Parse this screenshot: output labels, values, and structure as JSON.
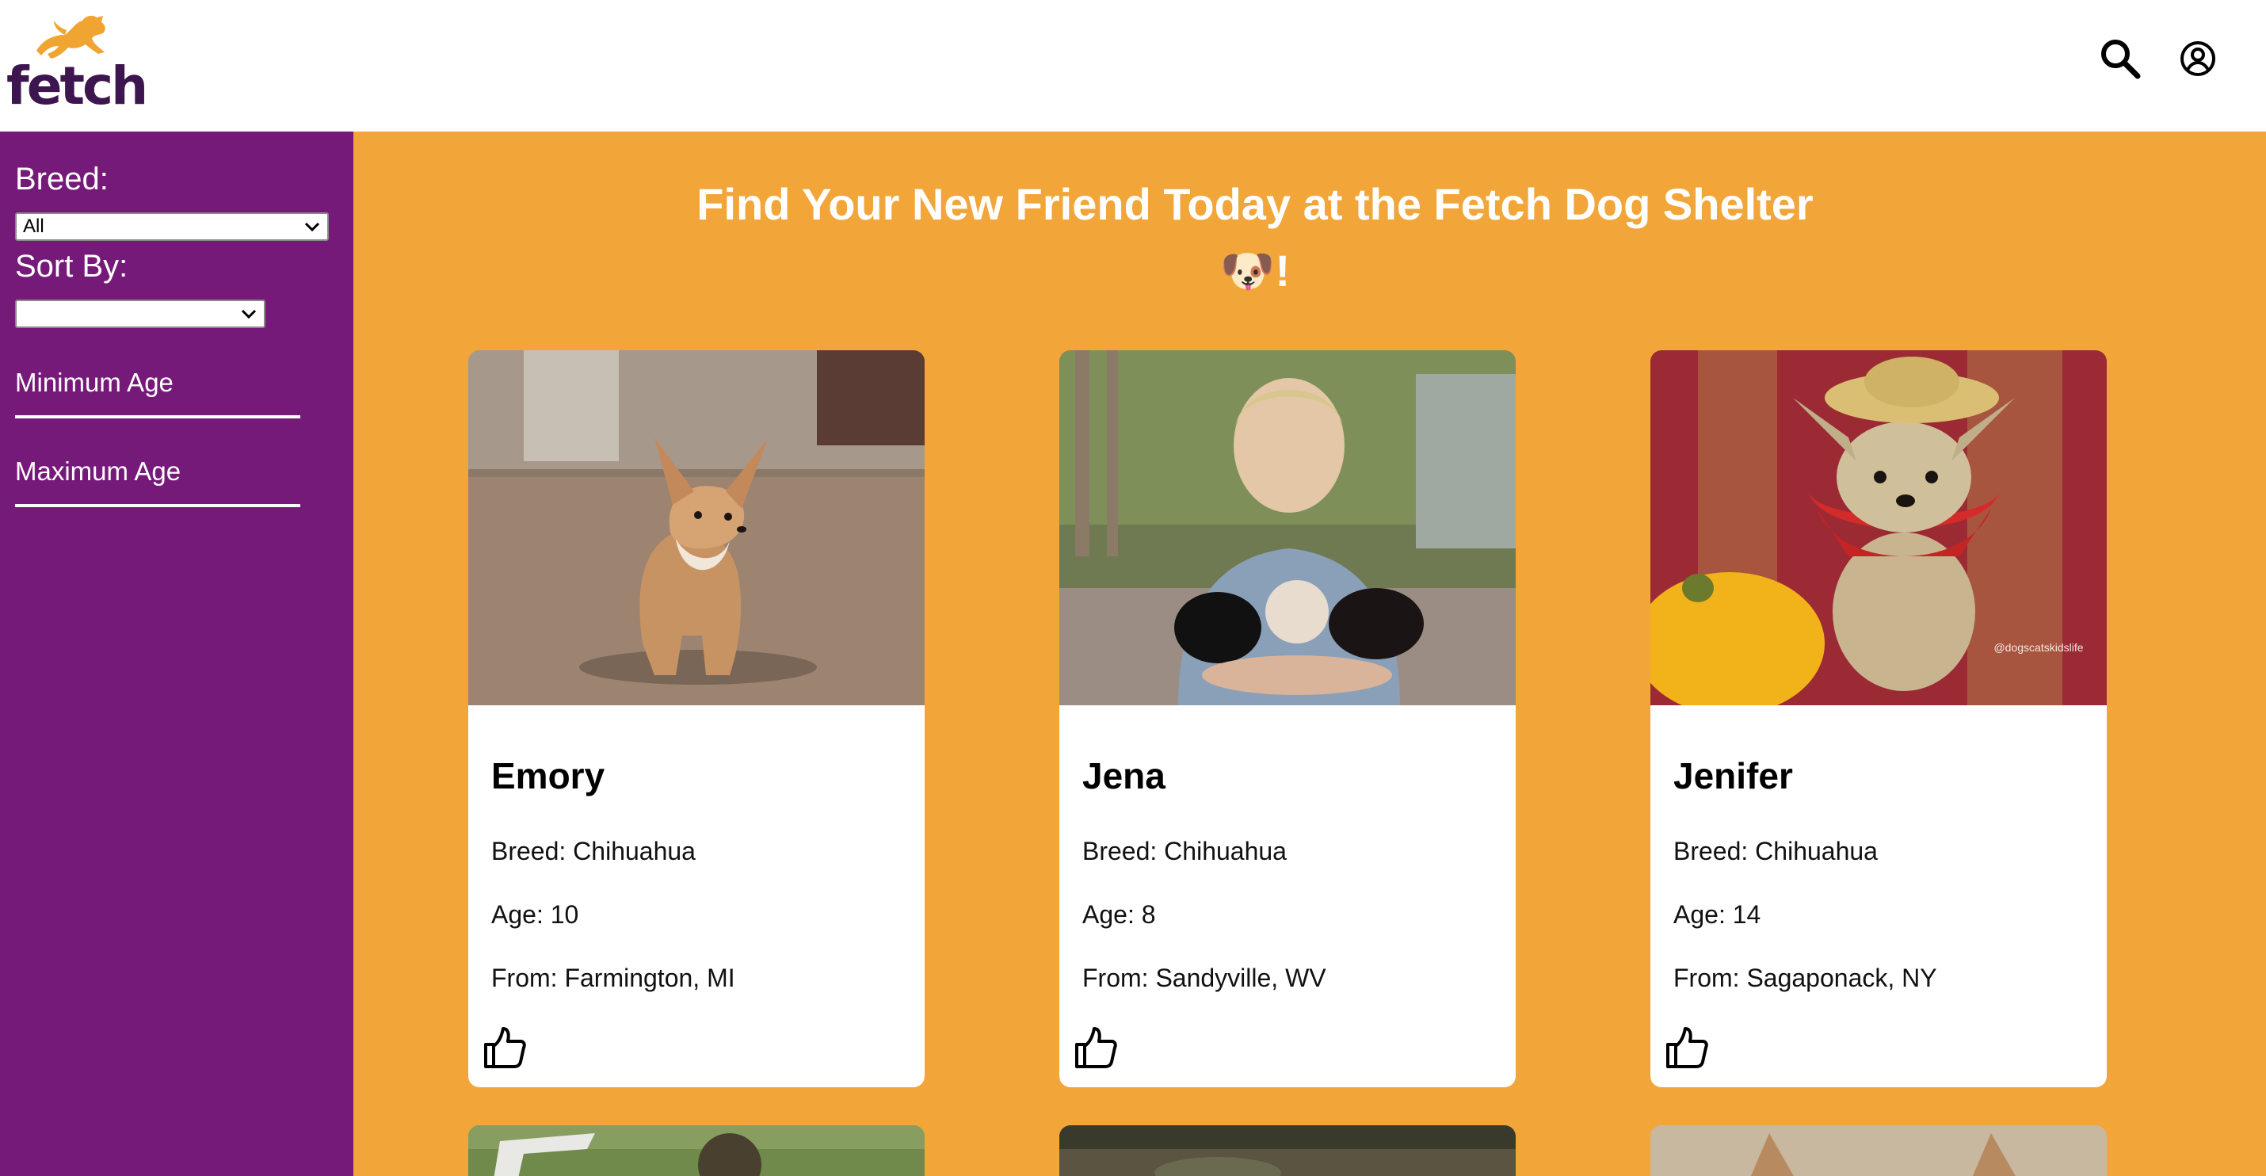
{
  "app": {
    "logo_text": "fetch"
  },
  "header": {
    "icons": [
      "search-icon",
      "account-circle-icon"
    ]
  },
  "sidebar": {
    "breed_label": "Breed:",
    "breed_selected": "All",
    "sort_label": "Sort By:",
    "sort_selected": "",
    "min_age_label": "Minimum Age",
    "max_age_label": "Maximum Age"
  },
  "main": {
    "title": "Find Your New Friend Today at the Fetch Dog Shelter",
    "title_suffix": "🐶!",
    "cards": [
      {
        "name": "Emory",
        "breed": "Breed: Chihuahua",
        "age": "Age: 10",
        "from": "From: Farmington, MI"
      },
      {
        "name": "Jena",
        "breed": "Breed: Chihuahua",
        "age": "Age: 8",
        "from": "From: Sandyville, WV"
      },
      {
        "name": "Jenifer",
        "breed": "Breed: Chihuahua",
        "age": "Age: 14",
        "from": "From: Sagaponack, NY",
        "photo_watermark": "@dogscatskidslife"
      }
    ]
  },
  "colors": {
    "sidebar": "#761a79",
    "main_bg": "#f2a63a",
    "logo_dog": "#f0a532",
    "logo_text": "#3d1650"
  }
}
